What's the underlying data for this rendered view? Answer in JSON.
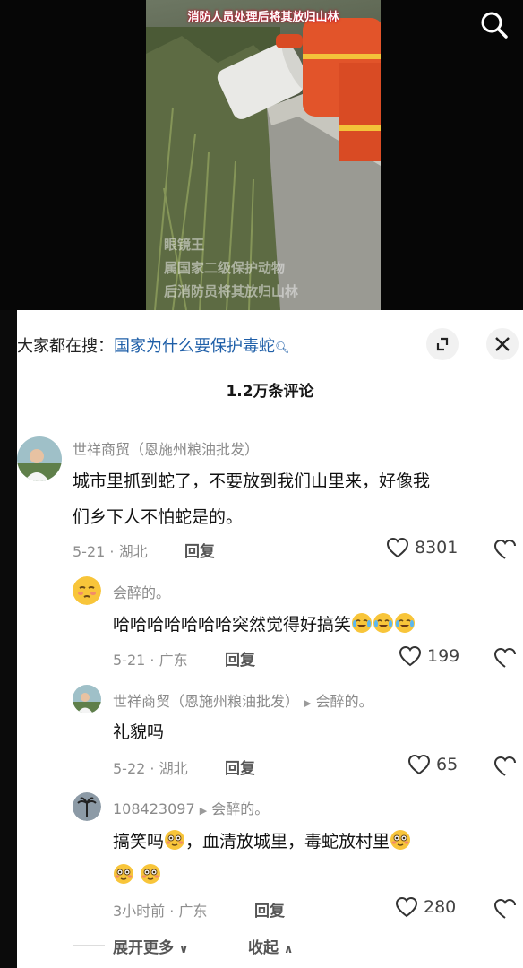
{
  "video": {
    "caption": "消防人员处理后将其放归山林",
    "overlay_lines": [
      "眼镜王",
      "属国家二级保护动物",
      "后消防员将其放归山林"
    ]
  },
  "hot_search": {
    "prefix": "大家都在搜：",
    "query": "国家为什么要保护毒蛇"
  },
  "comments_header": {
    "count_label": "1.2万条评论"
  },
  "comments": [
    {
      "author": "世祥商贸（恩施州粮油批发）",
      "lines": [
        "城市里抓到蛇了，不要放到我们山里来，好像我",
        "们乡下人不怕蛇是的。"
      ],
      "meta": "5-21 · 湖北",
      "reply_label": "回复",
      "likes": "8301"
    },
    {
      "author": "会醉的。",
      "text": "哈哈哈哈哈哈哈突然觉得好搞笑",
      "meta": "5-21 · 广东",
      "reply_label": "回复",
      "likes": "199"
    },
    {
      "author": "世祥商贸（恩施州粮油批发）",
      "reply_to": "会醉的。",
      "text": "礼貌吗",
      "meta": "5-22 · 湖北",
      "reply_label": "回复",
      "likes": "65"
    },
    {
      "author": "108423097",
      "reply_to": "会醉的。",
      "text_a": "搞笑吗",
      "text_b": "，血清放城里，毒蛇放村里",
      "meta": "3小时前 · 广东",
      "reply_label": "回复",
      "likes": "280"
    }
  ],
  "footer": {
    "expand_label": "展开更多",
    "collapse_label": "收起"
  }
}
